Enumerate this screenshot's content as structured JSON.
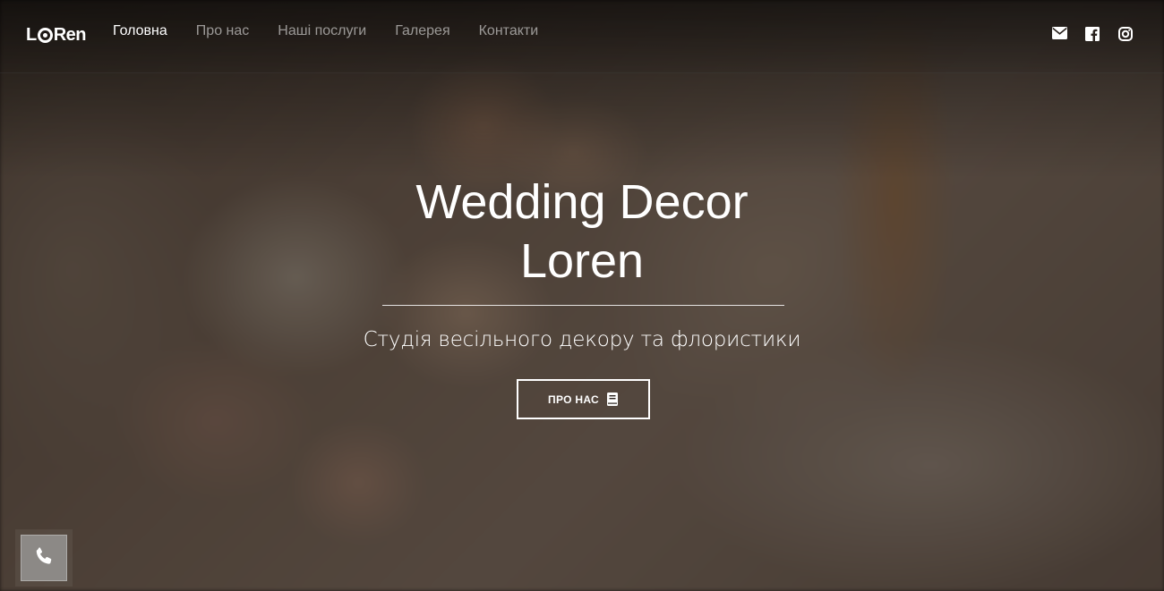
{
  "brand": {
    "logo_prefix": "L",
    "logo_suffix": "Ren"
  },
  "nav": {
    "items": [
      {
        "label": "Головна",
        "active": true
      },
      {
        "label": "Про нас",
        "active": false
      },
      {
        "label": "Наші послуги",
        "active": false
      },
      {
        "label": "Галерея",
        "active": false
      },
      {
        "label": "Контакти",
        "active": false
      }
    ]
  },
  "social": {
    "icons": [
      "mail-icon",
      "facebook-icon",
      "instagram-icon"
    ]
  },
  "hero": {
    "title_line1": "Wedding Decor",
    "title_line2": "Loren",
    "subtitle": "Студія весільного декору та флористики",
    "cta_label": "ПРО НАС"
  },
  "colors": {
    "text": "#ffffff",
    "nav_inactive": "#9a948f",
    "phone_button": "#8c8986"
  }
}
